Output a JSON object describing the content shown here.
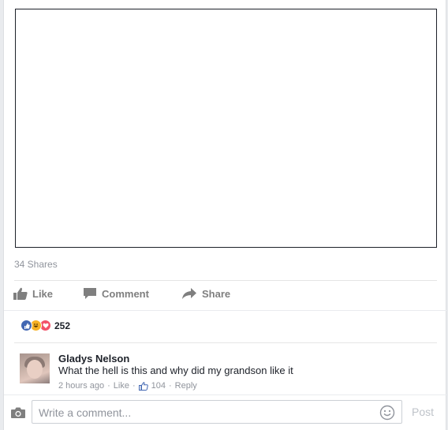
{
  "post": {
    "shares_text": "34 Shares"
  },
  "actions": {
    "like_label": "Like",
    "comment_label": "Comment",
    "share_label": "Share"
  },
  "reactions": {
    "types": [
      "like-icon",
      "haha-icon",
      "love-icon"
    ],
    "count": "252"
  },
  "comment": {
    "author": "Gladys Nelson",
    "text": "What the hell is this and why did my grandson like it",
    "time": "2 hours ago",
    "like_label": "Like",
    "like_count": "104",
    "reply_label": "Reply"
  },
  "composer": {
    "placeholder": "Write a comment...",
    "post_label": "Post"
  },
  "colors": {
    "muted_text": "#90949c",
    "action_text": "#7f7f7f",
    "like_blue": "#4267b2",
    "haha_yellow": "#f7b125",
    "love_red": "#f25268"
  }
}
